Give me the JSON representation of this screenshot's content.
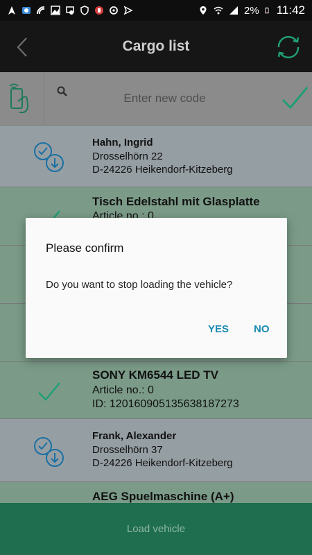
{
  "status_bar": {
    "battery": "2%",
    "time": "11:42"
  },
  "app_bar": {
    "title": "Cargo list",
    "back_icon": "chevron-left-icon",
    "sync_icon": "sync-icon"
  },
  "search": {
    "placeholder": "Enter new code",
    "value": ""
  },
  "list": {
    "items": [
      {
        "type": "customer",
        "line1": "Hahn, Ingrid",
        "line2": "Drosselhörn 22",
        "line3": "D-24226 Heikendorf-Kitzeberg"
      },
      {
        "type": "article",
        "line1": "Tisch Edelstahl mit Glasplatte",
        "line2": "Article no.: 0",
        "line3": ""
      },
      {
        "type": "article",
        "line1": "",
        "line2": "",
        "line3": ""
      },
      {
        "type": "article",
        "line1": "",
        "line2": "",
        "line3": ""
      },
      {
        "type": "article",
        "line1": "SONY KM6544 LED TV",
        "line2": "Article no.: 0",
        "line3": "ID: 120160905135638187273"
      },
      {
        "type": "customer",
        "line1": "Frank, Alexander",
        "line2": "Drosselhörn 37",
        "line3": "D-24226 Heikendorf-Kitzeberg"
      },
      {
        "type": "article",
        "line1": "AEG Spuelmaschine (A+)",
        "line2": "",
        "line3": ""
      }
    ]
  },
  "bottom": {
    "load_label": "Load vehicle"
  },
  "dialog": {
    "title": "Please confirm",
    "message": "Do you want to stop loading the vehicle?",
    "yes_label": "YES",
    "no_label": "NO"
  },
  "colors": {
    "accent": "#2bb58a",
    "dialog_button": "#1a8ab0"
  }
}
